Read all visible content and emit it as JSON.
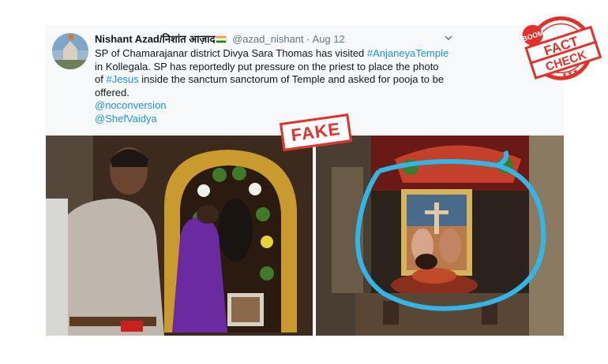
{
  "tweet": {
    "display_name": "Nishant Azad/निशांत आज़ाद",
    "handle": "@azad_nishant",
    "separator": "·",
    "date": "Aug 12",
    "lines": [
      {
        "pre": "SP of Chamarajanar district Divya Sara Thomas has visited ",
        "link": "#AnjaneyaTemple",
        "post": ""
      },
      {
        "pre": "in Kollegala. SP has reportedly put pressure on the priest to place the photo",
        "link": "",
        "post": ""
      },
      {
        "pre": "of ",
        "link": "#Jesus",
        "post": " inside the sanctum sanctorum of Temple and asked for pooja to be"
      },
      {
        "pre": "offered.",
        "link": "",
        "post": ""
      }
    ],
    "mentions": [
      "@noconversion",
      "@ShefVaidya"
    ],
    "menu_icon": "chevron-down-icon"
  },
  "badges": {
    "fake_label": "FAKE",
    "stamp_brand": "BOOM",
    "stamp_line1": "FACT",
    "stamp_line2": "CHECK",
    "stamp_stars": "★★★"
  },
  "colors": {
    "link": "#1b95e0",
    "stamp_red": "#e0312a",
    "circle_blue": "#33b5e5"
  }
}
